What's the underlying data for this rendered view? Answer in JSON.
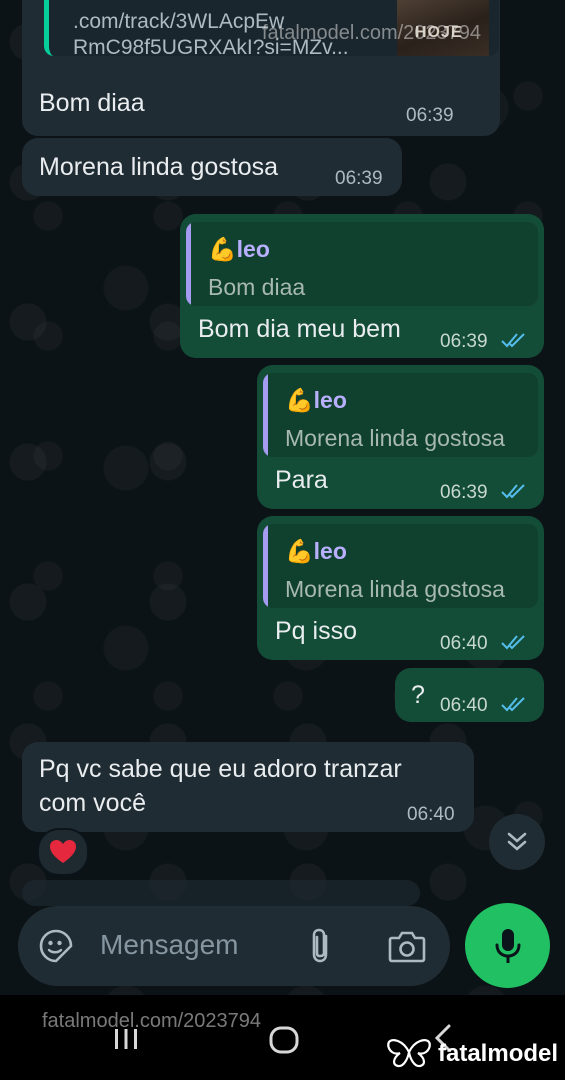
{
  "conversation": {
    "link_preview": {
      "line1": ".com/track/3WLAcpEw",
      "line2": "RmC98f5UGRXAkI?si=MZv...",
      "thumb_text": "HOJE"
    },
    "messages": [
      {
        "direction": "in",
        "text": "Bom diaa",
        "time": "06:39"
      },
      {
        "direction": "in",
        "text": "Morena linda gostosa",
        "time": "06:39"
      },
      {
        "direction": "out",
        "reply_author": "leo",
        "reply_text": "Bom diaa",
        "text": "Bom dia meu bem",
        "time": "06:39",
        "status": "read"
      },
      {
        "direction": "out",
        "reply_author": "leo",
        "reply_text": "Morena linda gostosa",
        "text": "Para",
        "time": "06:39",
        "status": "read"
      },
      {
        "direction": "out",
        "reply_author": "leo",
        "reply_text": "Morena linda gostosa",
        "text": "Pq isso",
        "time": "06:40",
        "status": "read"
      },
      {
        "direction": "out",
        "text": "?",
        "time": "06:40",
        "status": "read"
      },
      {
        "direction": "in",
        "text_line1": "Pq vc sabe que eu adoro tranzar",
        "text_line2": "com você",
        "time": "06:40",
        "reaction": "heart"
      }
    ]
  },
  "composer": {
    "placeholder": "Mensagem",
    "icons": [
      "sticker-icon",
      "attach-icon",
      "camera-icon",
      "mic-icon"
    ]
  },
  "watermarks": {
    "top": "fatalmodel.com/2023794",
    "bottom": "fatalmodel.com/2023794",
    "brand": "fatalmodel"
  },
  "colors": {
    "incoming": "#202c33",
    "outgoing": "#144d37",
    "accent_green": "#21c063",
    "read_ticks": "#53bdeb",
    "reply_bar": "#a59cf2"
  }
}
